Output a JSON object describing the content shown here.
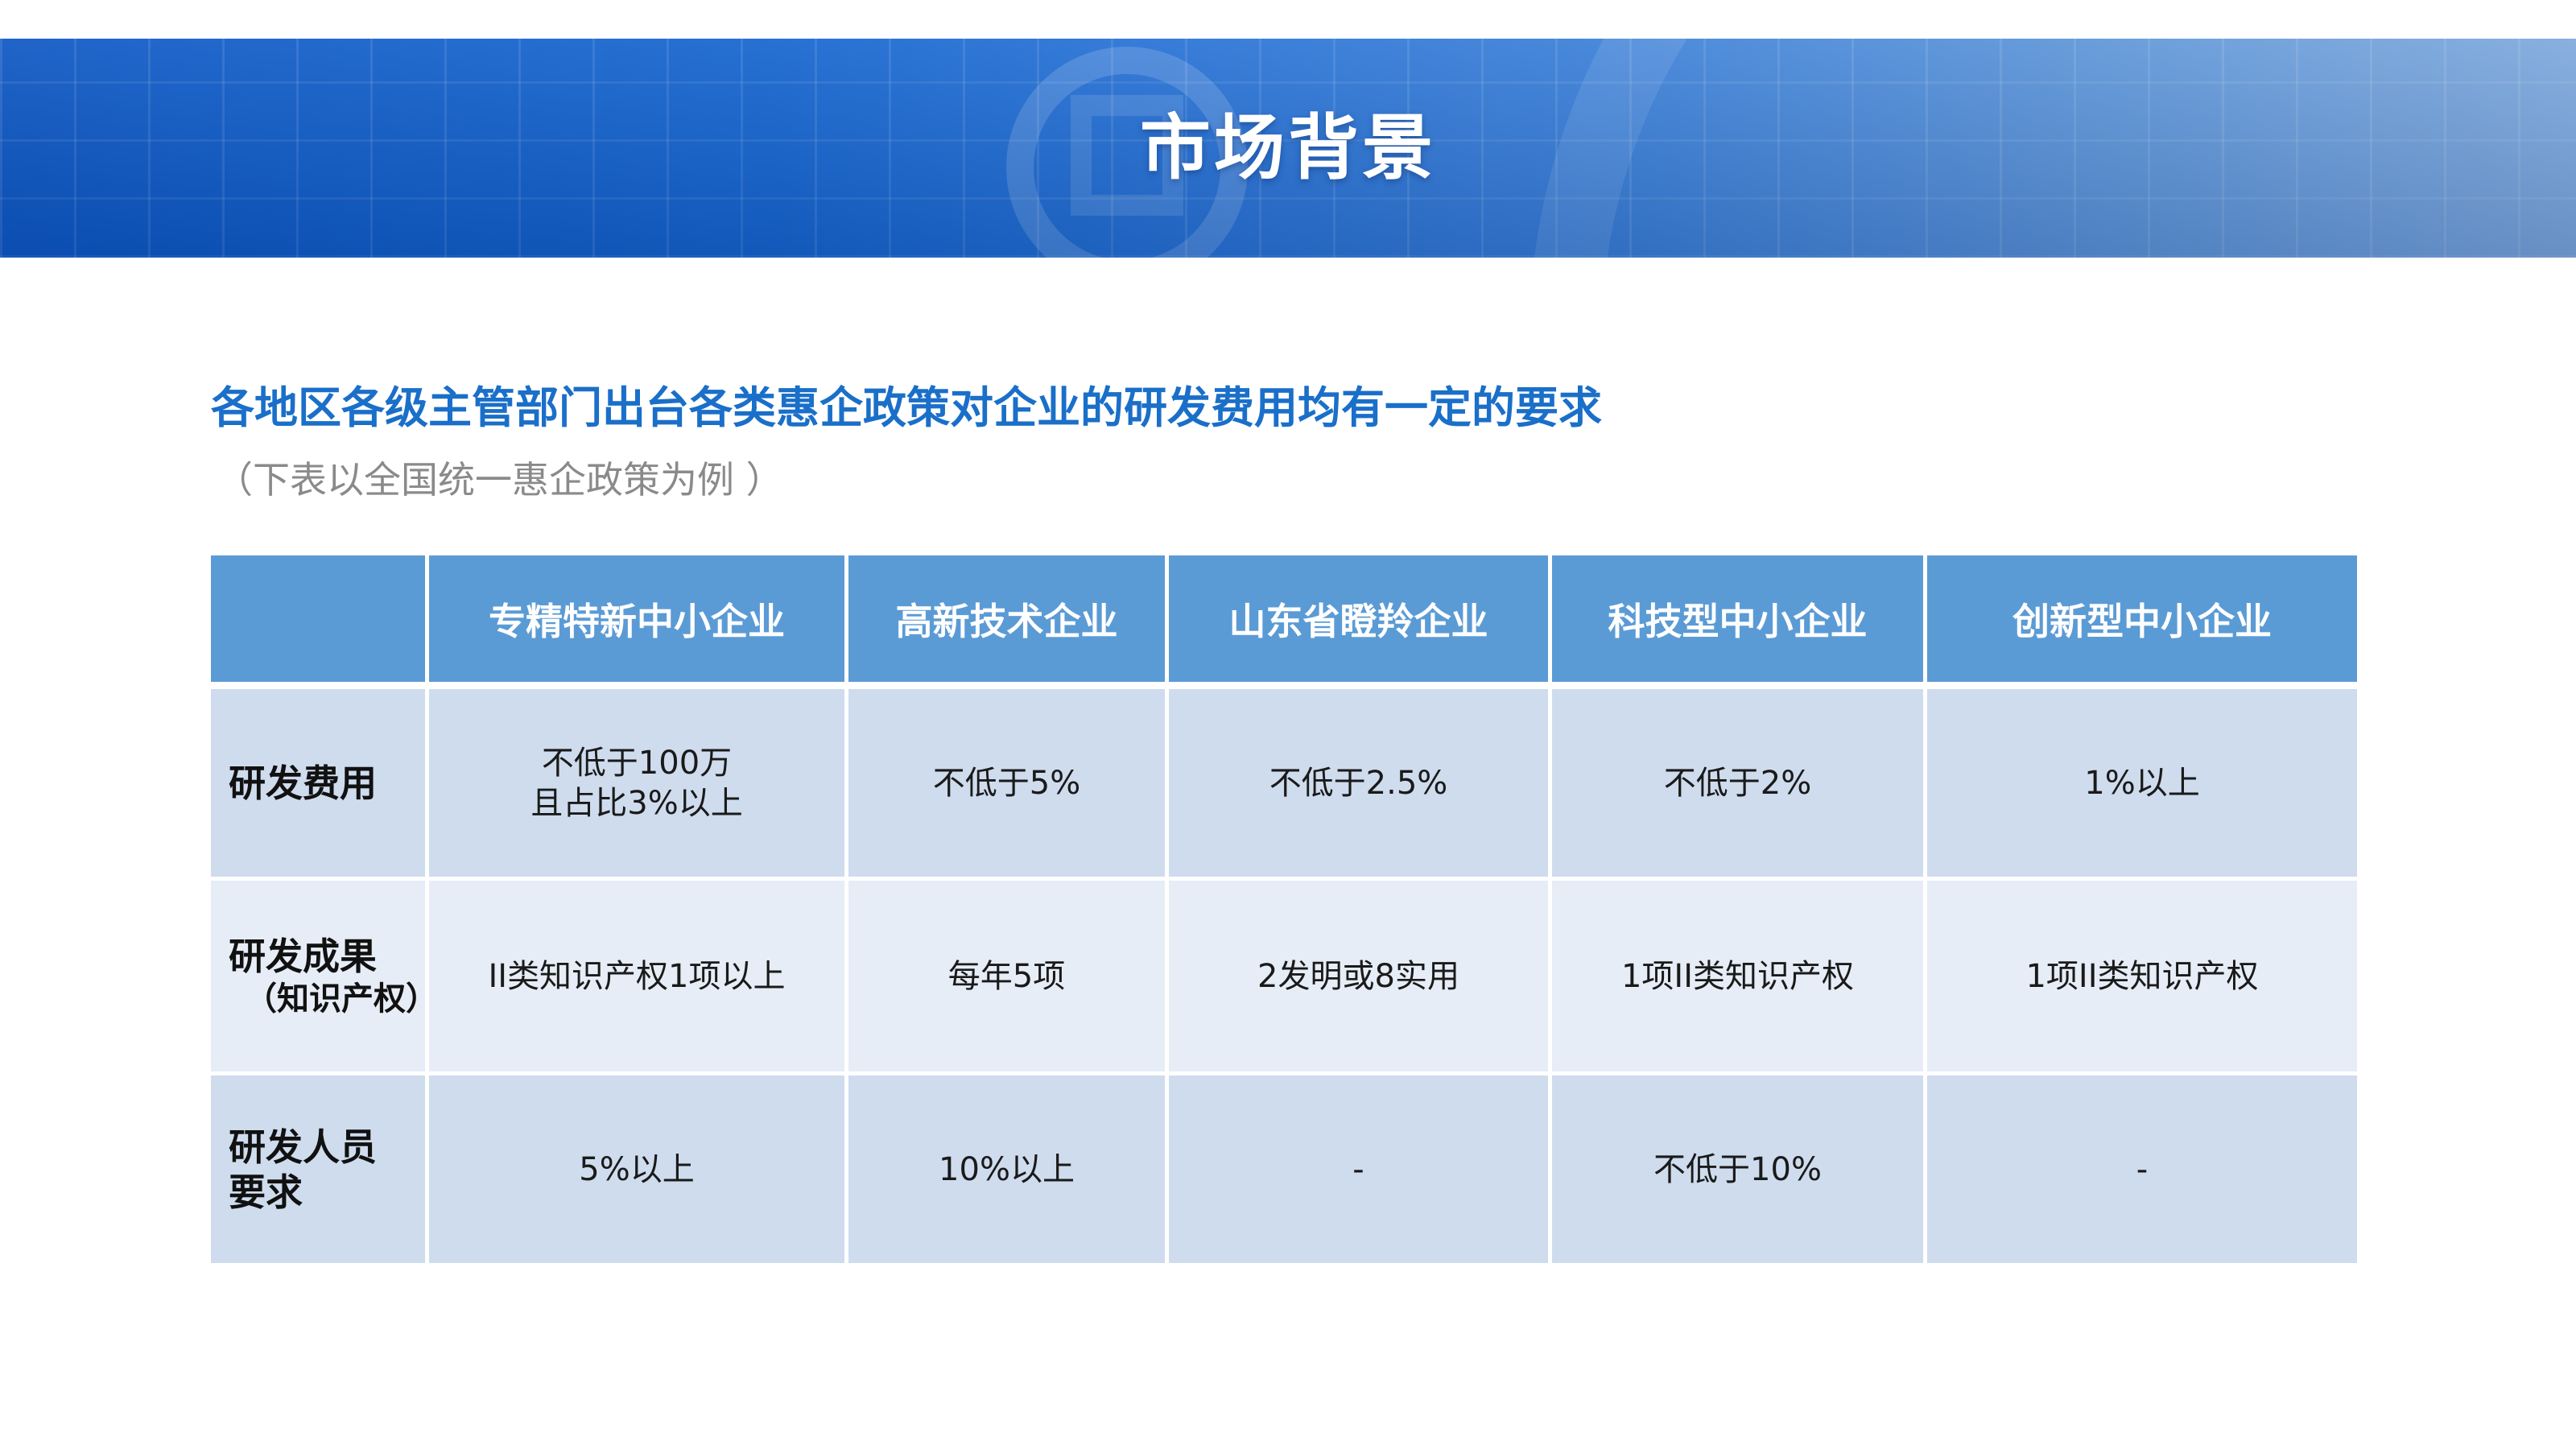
{
  "banner": {
    "title": "市场背景"
  },
  "heading": "各地区各级主管部门出台各类惠企政策对企业的研发费用均有一定的要求",
  "subheading": "（下表以全国统一惠企政策为例 ）",
  "table": {
    "corner": "",
    "columns": [
      "专精特新中小企业",
      "高新技术企业",
      "山东省瞪羚企业",
      "科技型中小企业",
      "创新型中小企业"
    ],
    "rows": [
      {
        "label": "研发费用",
        "label_sub": "",
        "cells": [
          [
            "不低于100万",
            "且占比3%以上"
          ],
          [
            "不低于5%"
          ],
          [
            "不低于2.5%"
          ],
          [
            "不低于2%"
          ],
          [
            "1%以上"
          ]
        ]
      },
      {
        "label": "研发成果",
        "label_sub": "（知识产权）",
        "cells": [
          [
            "II类知识产权1项以上"
          ],
          [
            "每年5项"
          ],
          [
            "2发明或8实用"
          ],
          [
            "1项II类知识产权"
          ],
          [
            "1项II类知识产权"
          ]
        ]
      },
      {
        "label": "研发人员",
        "label_sub": "要求",
        "cells": [
          [
            "5%以上"
          ],
          [
            "10%以上"
          ],
          [
            "-"
          ],
          [
            "不低于10%"
          ],
          [
            "-"
          ]
        ]
      }
    ]
  }
}
